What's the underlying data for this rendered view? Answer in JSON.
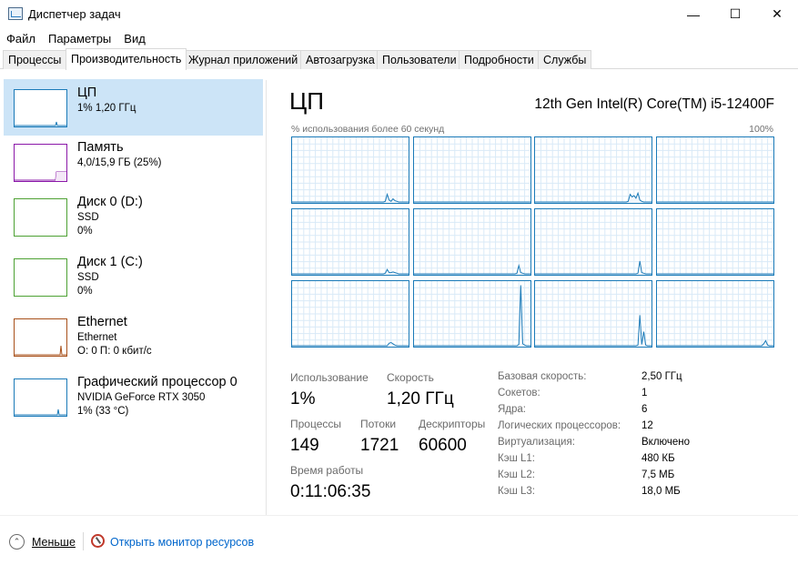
{
  "window": {
    "title": "Диспетчер задач",
    "minimize_glyph": "—",
    "maximize_glyph": "☐",
    "close_glyph": "✕"
  },
  "menu": [
    "Файл",
    "Параметры",
    "Вид"
  ],
  "tabs": [
    {
      "label": "Процессы",
      "active": false
    },
    {
      "label": "Производительность",
      "active": true
    },
    {
      "label": "Журнал приложений",
      "active": false
    },
    {
      "label": "Автозагрузка",
      "active": false
    },
    {
      "label": "Пользователи",
      "active": false
    },
    {
      "label": "Подробности",
      "active": false
    },
    {
      "label": "Службы",
      "active": false
    }
  ],
  "resources": [
    {
      "title": "ЦП",
      "line1": "1% 1,20 ГГц",
      "line2": "",
      "color": "#1a7ab8",
      "selected": true
    },
    {
      "title": "Память",
      "line1": "4,0/15,9 ГБ (25%)",
      "line2": "",
      "color": "#8b18a8",
      "selected": false
    },
    {
      "title": "Диск 0 (D:)",
      "line1": "SSD",
      "line2": "0%",
      "color": "#4da133",
      "selected": false
    },
    {
      "title": "Диск 1 (C:)",
      "line1": "SSD",
      "line2": "0%",
      "color": "#4da133",
      "selected": false
    },
    {
      "title": "Ethernet",
      "line1": "Ethernet",
      "line2": "О: 0 П: 0 кбит/с",
      "color": "#a8501a",
      "selected": false
    },
    {
      "title": "Графический процессор 0",
      "line1": "NVIDIA GeForce RTX 3050",
      "line2": "1% (33 °C)",
      "color": "#1a7ab8",
      "selected": false
    }
  ],
  "cpu": {
    "title": "ЦП",
    "model": "12th Gen Intel(R) Core(TM) i5-12400F",
    "graph_caption": "% использования более 60 секунд",
    "graph_max": "100%",
    "accent_color": "#1a7ab8"
  },
  "stats": {
    "usage_label": "Использование",
    "usage_value": "1%",
    "speed_label": "Скорость",
    "speed_value": "1,20 ГГц",
    "processes_label": "Процессы",
    "processes_value": "149",
    "threads_label": "Потоки",
    "threads_value": "1721",
    "handles_label": "Дескрипторы",
    "handles_value": "60600",
    "uptime_label": "Время работы",
    "uptime_value": "0:11:06:35"
  },
  "info": [
    {
      "label": "Базовая скорость:",
      "value": "2,50 ГГц"
    },
    {
      "label": "Сокетов:",
      "value": "1"
    },
    {
      "label": "Ядра:",
      "value": "6"
    },
    {
      "label": "Логических процессоров:",
      "value": "12"
    },
    {
      "label": "Виртуализация:",
      "value": "Включено"
    },
    {
      "label": "Кэш L1:",
      "value": "480 КБ"
    },
    {
      "label": "Кэш L2:",
      "value": "7,5 МБ"
    },
    {
      "label": "Кэш L3:",
      "value": "18,0 МБ"
    }
  ],
  "footer": {
    "less_label": "Меньше",
    "monitor_label": "Открыть монитор ресурсов"
  },
  "chart_data": {
    "type": "line",
    "x_range": [
      0,
      60
    ],
    "ylim": [
      0,
      100
    ],
    "series": [
      {
        "values": [
          0,
          0,
          0,
          0,
          0,
          0,
          0,
          0,
          0,
          0,
          0,
          0,
          0,
          0,
          0,
          0,
          0,
          0,
          0,
          0,
          0,
          0,
          0,
          0,
          0,
          0,
          0,
          0,
          0,
          0,
          0,
          0,
          0,
          0,
          0,
          0,
          0,
          0,
          0,
          0,
          0,
          0,
          0,
          0,
          0,
          0,
          0,
          0,
          1,
          12,
          3,
          1,
          5,
          2,
          1,
          0,
          0,
          0,
          0,
          0,
          0
        ]
      },
      {
        "values": [
          0,
          0,
          0,
          0,
          0,
          0,
          0,
          0,
          0,
          0,
          0,
          0,
          0,
          0,
          0,
          0,
          0,
          0,
          0,
          0,
          0,
          0,
          0,
          0,
          0,
          0,
          0,
          0,
          0,
          0,
          0,
          0,
          0,
          0,
          0,
          0,
          0,
          0,
          0,
          0,
          0,
          0,
          0,
          0,
          0,
          0,
          0,
          0,
          0,
          0,
          0,
          0,
          0,
          0,
          0,
          0,
          0,
          0,
          0,
          0,
          0
        ]
      },
      {
        "values": [
          0,
          0,
          0,
          0,
          0,
          0,
          0,
          0,
          0,
          0,
          0,
          0,
          0,
          0,
          0,
          0,
          0,
          0,
          0,
          0,
          0,
          0,
          0,
          0,
          0,
          0,
          0,
          0,
          0,
          0,
          0,
          0,
          0,
          0,
          0,
          0,
          0,
          0,
          0,
          0,
          0,
          0,
          0,
          0,
          0,
          0,
          0,
          0,
          1,
          12,
          8,
          10,
          6,
          14,
          3,
          1,
          0,
          0,
          0,
          0,
          0
        ]
      },
      {
        "values": [
          0,
          0,
          0,
          0,
          0,
          0,
          0,
          0,
          0,
          0,
          0,
          0,
          0,
          0,
          0,
          0,
          0,
          0,
          0,
          0,
          0,
          0,
          0,
          0,
          0,
          0,
          0,
          0,
          0,
          0,
          0,
          0,
          0,
          0,
          0,
          0,
          0,
          0,
          0,
          0,
          0,
          0,
          0,
          0,
          0,
          0,
          0,
          0,
          0,
          0,
          0,
          0,
          0,
          0,
          0,
          0,
          0,
          0,
          0,
          0,
          0
        ]
      },
      {
        "values": [
          0,
          0,
          0,
          0,
          0,
          0,
          0,
          0,
          0,
          0,
          0,
          0,
          0,
          0,
          0,
          0,
          0,
          0,
          0,
          0,
          0,
          0,
          0,
          0,
          0,
          0,
          0,
          0,
          0,
          0,
          0,
          0,
          0,
          0,
          0,
          0,
          0,
          0,
          0,
          0,
          0,
          0,
          0,
          0,
          0,
          0,
          0,
          0,
          1,
          7,
          2,
          2,
          3,
          2,
          1,
          0,
          0,
          0,
          0,
          0,
          0
        ]
      },
      {
        "values": [
          0,
          0,
          0,
          0,
          0,
          0,
          0,
          0,
          0,
          0,
          0,
          0,
          0,
          0,
          0,
          0,
          0,
          0,
          0,
          0,
          0,
          0,
          0,
          0,
          0,
          0,
          0,
          0,
          0,
          0,
          0,
          0,
          0,
          0,
          0,
          0,
          0,
          0,
          0,
          0,
          0,
          0,
          0,
          0,
          0,
          0,
          0,
          0,
          0,
          0,
          0,
          0,
          0,
          1,
          13,
          2,
          1,
          0,
          0,
          0,
          0
        ]
      },
      {
        "values": [
          0,
          0,
          0,
          0,
          0,
          0,
          0,
          0,
          0,
          0,
          0,
          0,
          0,
          0,
          0,
          0,
          0,
          0,
          0,
          0,
          0,
          0,
          0,
          0,
          0,
          0,
          0,
          0,
          0,
          0,
          0,
          0,
          0,
          0,
          0,
          0,
          0,
          0,
          0,
          0,
          0,
          0,
          0,
          0,
          0,
          0,
          0,
          0,
          0,
          0,
          0,
          0,
          0,
          1,
          20,
          2,
          1,
          0,
          0,
          0,
          0
        ]
      },
      {
        "values": [
          0,
          0,
          0,
          0,
          0,
          0,
          0,
          0,
          0,
          0,
          0,
          0,
          0,
          0,
          0,
          0,
          0,
          0,
          0,
          0,
          0,
          0,
          0,
          0,
          0,
          0,
          0,
          0,
          0,
          0,
          0,
          0,
          0,
          0,
          0,
          0,
          0,
          0,
          0,
          0,
          0,
          0,
          0,
          0,
          0,
          0,
          0,
          0,
          0,
          0,
          0,
          0,
          0,
          0,
          0,
          0,
          0,
          0,
          0,
          0,
          0
        ]
      },
      {
        "values": [
          0,
          0,
          0,
          0,
          0,
          0,
          0,
          0,
          0,
          0,
          0,
          0,
          0,
          0,
          0,
          0,
          0,
          0,
          0,
          0,
          0,
          0,
          0,
          0,
          0,
          0,
          0,
          0,
          0,
          0,
          0,
          0,
          0,
          0,
          0,
          0,
          0,
          0,
          0,
          0,
          0,
          0,
          0,
          0,
          0,
          0,
          0,
          0,
          0,
          0,
          4,
          5,
          3,
          1,
          0,
          0,
          0,
          0,
          0,
          0,
          0
        ]
      },
      {
        "values": [
          0,
          0,
          0,
          0,
          0,
          0,
          0,
          0,
          0,
          0,
          0,
          0,
          0,
          0,
          0,
          0,
          0,
          0,
          0,
          0,
          0,
          0,
          0,
          0,
          0,
          0,
          0,
          0,
          0,
          0,
          0,
          0,
          0,
          0,
          0,
          0,
          0,
          0,
          0,
          0,
          0,
          0,
          0,
          0,
          0,
          0,
          0,
          0,
          0,
          0,
          0,
          0,
          0,
          0,
          2,
          95,
          3,
          1,
          0,
          0,
          0
        ]
      },
      {
        "values": [
          0,
          0,
          0,
          0,
          0,
          0,
          0,
          0,
          0,
          0,
          0,
          0,
          0,
          0,
          0,
          0,
          0,
          0,
          0,
          0,
          0,
          0,
          0,
          0,
          0,
          0,
          0,
          0,
          0,
          0,
          0,
          0,
          0,
          0,
          0,
          0,
          0,
          0,
          0,
          0,
          0,
          0,
          0,
          0,
          0,
          0,
          0,
          0,
          0,
          0,
          0,
          0,
          0,
          1,
          48,
          2,
          22,
          1,
          0,
          0,
          0
        ]
      },
      {
        "values": [
          0,
          0,
          0,
          0,
          0,
          0,
          0,
          0,
          0,
          0,
          0,
          0,
          0,
          0,
          0,
          0,
          0,
          0,
          0,
          0,
          0,
          0,
          0,
          0,
          0,
          0,
          0,
          0,
          0,
          0,
          0,
          0,
          0,
          0,
          0,
          0,
          0,
          0,
          0,
          0,
          0,
          0,
          0,
          0,
          0,
          0,
          0,
          0,
          0,
          0,
          0,
          0,
          0,
          0,
          0,
          3,
          8,
          1,
          0,
          0,
          0
        ]
      }
    ]
  }
}
